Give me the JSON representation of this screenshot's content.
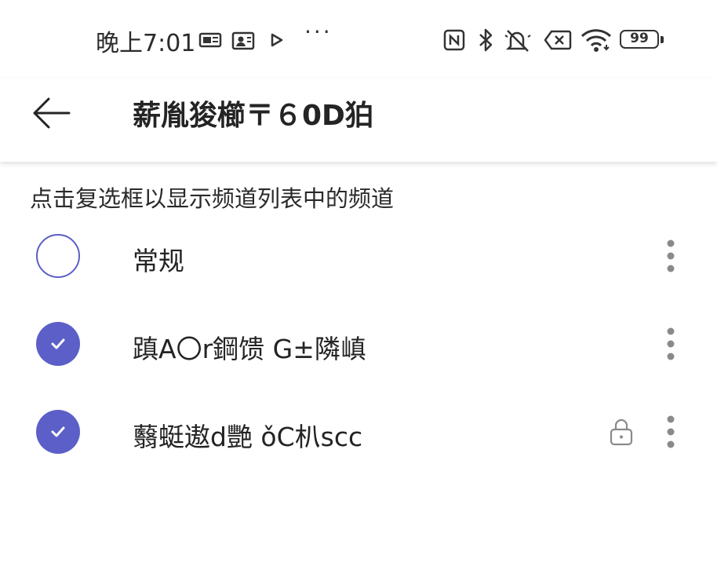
{
  "status_bar": {
    "time": "晚上7:01",
    "overflow": "···",
    "battery": "99",
    "icons": [
      "message-icon",
      "contact-card-icon",
      "play-store-icon",
      "nfc-icon",
      "bluetooth-icon",
      "mute-icon",
      "no-sim-icon",
      "wifi-icon",
      "battery-icon"
    ]
  },
  "header": {
    "title": "薪胤狻櫛〒６0D狛"
  },
  "hint": "点击复选框以显示频道列表中的频道",
  "channels": [
    {
      "name": "常规",
      "checked": false,
      "locked": false
    },
    {
      "name": "蹎A〇r鋼馈 G±隣嵮",
      "checked": true,
      "locked": false
    },
    {
      "name": "蘙蜓遨d艷 ǒC朳scc",
      "checked": true,
      "locked": true
    }
  ],
  "colors": {
    "accent": "#5b5fc7",
    "text": "#242424",
    "icon_gray": "#8a8a8a"
  }
}
